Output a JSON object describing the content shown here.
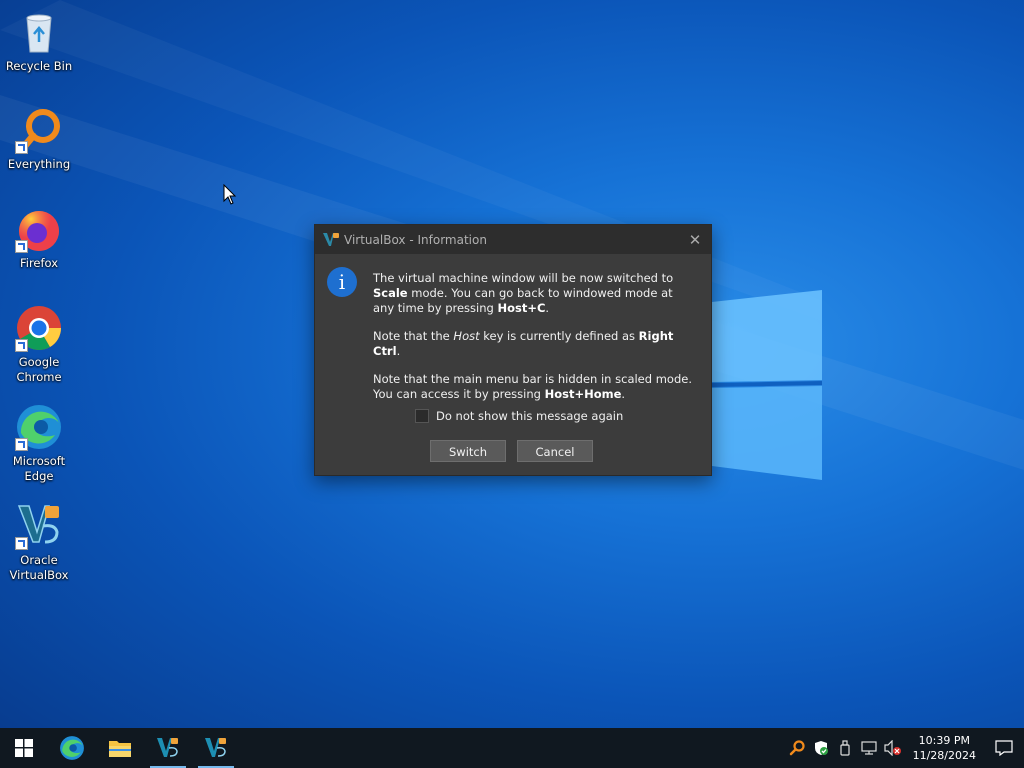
{
  "desktop": {
    "icons": [
      {
        "label_line1": "Recycle Bin",
        "label_line2": "",
        "icon": "recycle-bin-icon"
      },
      {
        "label_line1": "Everything",
        "label_line2": "",
        "icon": "everything-search-icon"
      },
      {
        "label_line1": "Firefox",
        "label_line2": "",
        "icon": "firefox-icon"
      },
      {
        "label_line1": "Google",
        "label_line2": "Chrome",
        "icon": "chrome-icon"
      },
      {
        "label_line1": "Microsoft",
        "label_line2": "Edge",
        "icon": "edge-icon"
      },
      {
        "label_line1": "Oracle",
        "label_line2": "VirtualBox",
        "icon": "virtualbox-icon"
      }
    ]
  },
  "dialog": {
    "title": "VirtualBox - Information",
    "p1_a": "The virtual machine window will be now switched to ",
    "p1_b": "Scale",
    "p1_c": " mode. You can go back to windowed mode at any time by pressing ",
    "p1_d": "Host+C",
    "p1_e": ".",
    "p2_a": "Note that the ",
    "p2_b": "Host",
    "p2_c": " key is currently defined as ",
    "p2_d": "Right Ctrl",
    "p2_e": ".",
    "p3_a": "Note that the main menu bar is hidden in scaled mode. You can access it by pressing ",
    "p3_b": "Host+Home",
    "p3_c": ".",
    "checkbox_label": "Do not show this message again",
    "checkbox_checked": false,
    "switch_label": "Switch",
    "cancel_label": "Cancel"
  },
  "taskbar": {
    "clock_time": "10:39 PM",
    "clock_date": "11/28/2024",
    "accent": "#76b9ed"
  }
}
